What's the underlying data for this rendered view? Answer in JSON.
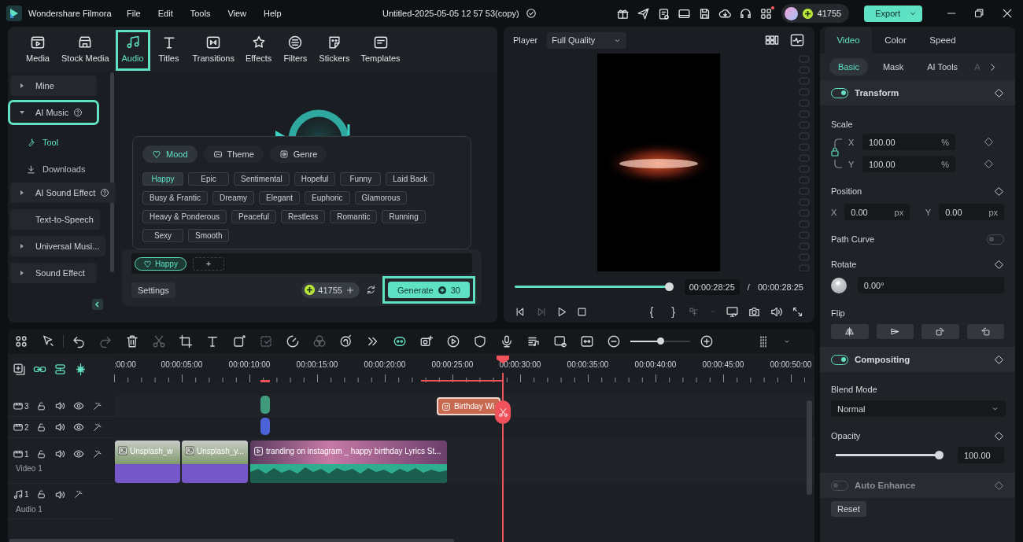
{
  "app": {
    "name": "Wondershare Filmora",
    "menu": [
      "File",
      "Edit",
      "Tools",
      "View",
      "Help"
    ],
    "project_title": "Untitled-2025-05-05 12 57 53(copy)",
    "credits": "41755",
    "export": "Export"
  },
  "media_tabs": [
    {
      "label": "Media",
      "selected": false,
      "highlighted": false
    },
    {
      "label": "Stock Media",
      "selected": false,
      "highlighted": false
    },
    {
      "label": "Audio",
      "selected": true,
      "highlighted": true
    },
    {
      "label": "Titles",
      "selected": false,
      "highlighted": false
    },
    {
      "label": "Transitions",
      "selected": false,
      "highlighted": false
    },
    {
      "label": "Effects",
      "selected": false,
      "highlighted": false
    },
    {
      "label": "Filters",
      "selected": false,
      "highlighted": false
    },
    {
      "label": "Stickers",
      "selected": false,
      "highlighted": false
    },
    {
      "label": "Templates",
      "selected": false,
      "highlighted": false
    }
  ],
  "sidebar": [
    {
      "label": "Mine",
      "kind": "group",
      "expanded": false,
      "help": false,
      "highlighted": false
    },
    {
      "label": "AI Music",
      "kind": "group",
      "expanded": true,
      "help": true,
      "highlighted": true,
      "children": [
        {
          "label": "Tool",
          "selected": true
        },
        {
          "label": "Downloads",
          "selected": false
        }
      ]
    },
    {
      "label": "AI Sound Effect",
      "kind": "group",
      "expanded": false,
      "help": true,
      "highlighted": false
    },
    {
      "label": "Text-to-Speech",
      "kind": "plain",
      "help": false,
      "highlighted": false
    },
    {
      "label": "Universal Musi...",
      "kind": "group",
      "expanded": false,
      "help": false,
      "highlighted": false
    },
    {
      "label": "Sound Effect",
      "kind": "group",
      "expanded": false,
      "help": false,
      "highlighted": false
    }
  ],
  "ai_music": {
    "categories": [
      {
        "label": "Mood",
        "selected": true
      },
      {
        "label": "Theme",
        "selected": false
      },
      {
        "label": "Genre",
        "selected": false
      }
    ],
    "tags": [
      {
        "label": "Happy",
        "selected": true
      },
      {
        "label": "Epic",
        "selected": false
      },
      {
        "label": "Sentimental",
        "selected": false
      },
      {
        "label": "Hopeful",
        "selected": false
      },
      {
        "label": "Funny",
        "selected": false
      },
      {
        "label": "Laid Back",
        "selected": false
      },
      {
        "label": "Busy & Frantic",
        "selected": false
      },
      {
        "label": "Dreamy",
        "selected": false
      },
      {
        "label": "Elegant",
        "selected": false
      },
      {
        "label": "Euphoric",
        "selected": false
      },
      {
        "label": "Glamorous",
        "selected": false
      },
      {
        "label": "Heavy & Ponderous",
        "selected": false
      },
      {
        "label": "Peaceful",
        "selected": false
      },
      {
        "label": "Restless",
        "selected": false
      },
      {
        "label": "Romantic",
        "selected": false
      },
      {
        "label": "Running",
        "selected": false
      },
      {
        "label": "Sexy",
        "selected": false
      },
      {
        "label": "Smooth",
        "selected": false
      }
    ],
    "chosen": [
      {
        "label": "Happy"
      }
    ],
    "add": "+",
    "settings": "Settings",
    "credits": "41755",
    "generate": {
      "label": "Generate",
      "cost": "30",
      "highlighted": true
    }
  },
  "player": {
    "label": "Player",
    "quality": "Full Quality",
    "progress": {
      "level": 1
    },
    "current_time": "00:00:28:25",
    "separator": "/",
    "total_time": "00:00:28:25",
    "mark_in": "{",
    "mark_out": "}"
  },
  "timeline": {
    "zoom": {
      "level": 0.5
    },
    "ruler": [
      ":00:00",
      "00:00:05:00",
      "00:00:10:00",
      "00:00:15:00",
      "00:00:20:00",
      "00:00:25:00",
      "00:00:30:00",
      "00:00:35:00",
      "00:00:40:00",
      "00:00:45:00",
      "00:00:50:00"
    ],
    "tracks": [
      {
        "kind": "video",
        "number": "3"
      },
      {
        "kind": "video",
        "number": "2"
      },
      {
        "kind": "video",
        "number": "1",
        "name": "Video 1"
      },
      {
        "kind": "audio",
        "number": "1",
        "name": "Audio 1"
      }
    ],
    "clips": [
      {
        "kind": "image",
        "label": "Unsplash_w"
      },
      {
        "kind": "image",
        "label": "Unsplash_y..."
      },
      {
        "kind": "video",
        "label": "tranding on instagram _ happy birthday Lyrics St..."
      },
      {
        "kind": "title",
        "label": "Birthday Wi"
      },
      {
        "kind": "marker",
        "color": "#3e9c7c"
      },
      {
        "kind": "marker",
        "color": "#4b62d8"
      }
    ]
  },
  "properties": {
    "tabs": [
      {
        "label": "Video",
        "selected": true
      },
      {
        "label": "Color",
        "selected": false
      },
      {
        "label": "Speed",
        "selected": false
      }
    ],
    "subtabs": [
      {
        "label": "Basic",
        "selected": true
      },
      {
        "label": "Mask",
        "selected": false
      },
      {
        "label": "AI Tools",
        "selected": false
      },
      {
        "label": "A",
        "selected": false
      }
    ],
    "transform": {
      "title": "Transform",
      "on": true,
      "scale_label": "Scale",
      "scale": [
        {
          "axis": "X",
          "value": "100.00",
          "unit": "%"
        },
        {
          "axis": "Y",
          "value": "100.00",
          "unit": "%"
        }
      ],
      "position_label": "Position",
      "position": [
        {
          "axis": "X",
          "value": "0.00",
          "unit": "px"
        },
        {
          "axis": "Y",
          "value": "0.00",
          "unit": "px"
        }
      ],
      "path_curve": {
        "label": "Path Curve",
        "on": false
      },
      "rotate_label": "Rotate",
      "rotate": "0.00°",
      "flip_label": "Flip"
    },
    "compositing": {
      "title": "Compositing",
      "on": true,
      "blend_label": "Blend Mode",
      "blend": "Normal",
      "opacity_label": "Opacity",
      "opacity": {
        "level": 1
      },
      "opacity_value": "100.00"
    },
    "auto_enhance": {
      "title": "Auto Enhance",
      "on": false
    },
    "reset": "Reset"
  }
}
